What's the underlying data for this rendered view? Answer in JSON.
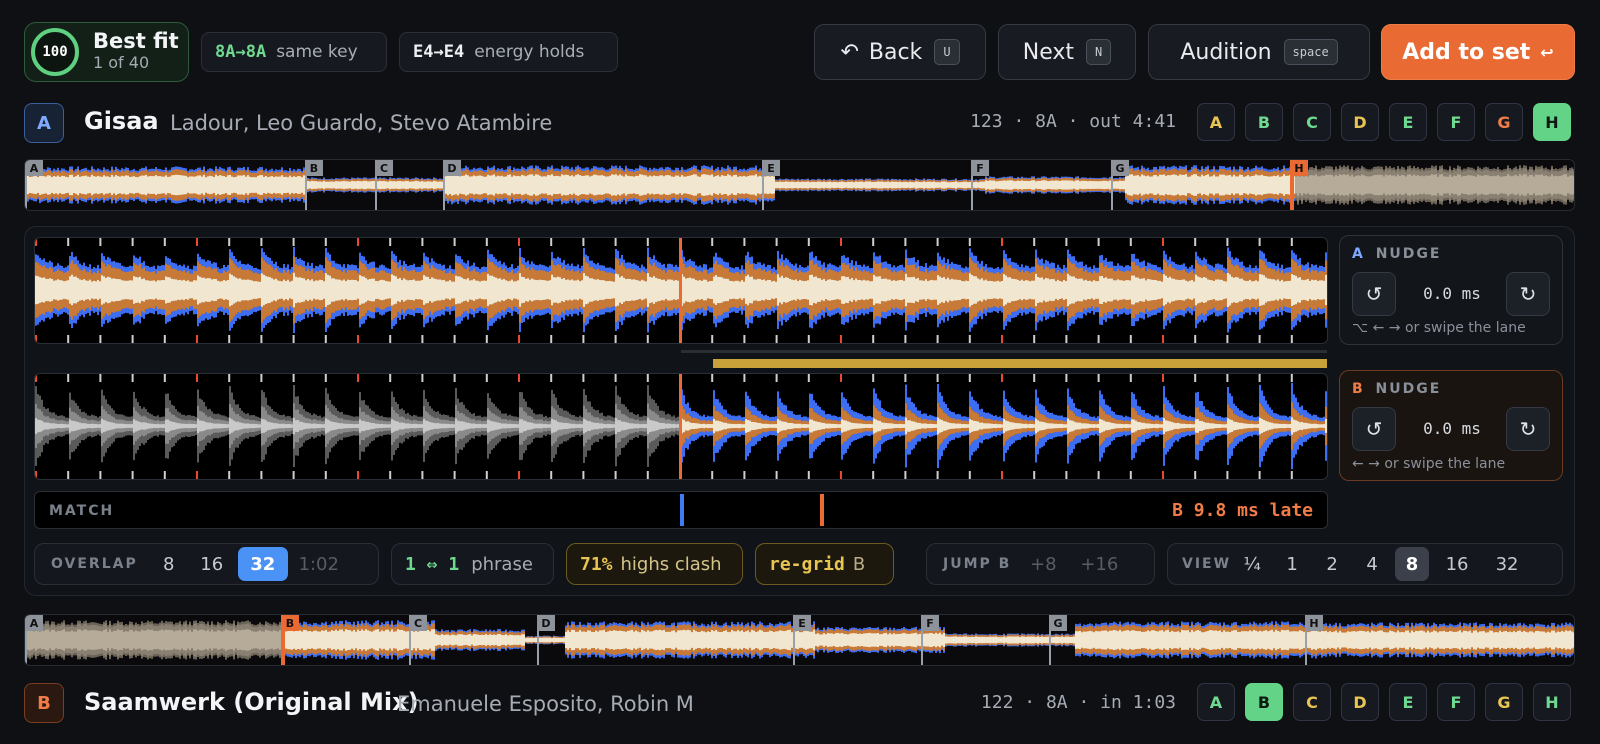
{
  "header": {
    "score": "100",
    "fit_title": "Best fit",
    "fit_sub": "1 of 40",
    "key_change": "8A→8A",
    "key_note": "same key",
    "energy_change": "E4→E4",
    "energy_note": "energy holds"
  },
  "buttons": {
    "back": {
      "label": "Back",
      "key": "U"
    },
    "next": {
      "label": "Next",
      "key": "N"
    },
    "audition": {
      "label": "Audition",
      "key": "space"
    },
    "add": {
      "label": "Add to set",
      "key": "↩"
    }
  },
  "trackA": {
    "deck": "A",
    "title": "Gisaa",
    "artists": "Ladour, Leo Guardo, Stevo Atambire",
    "meta": "123 · 8A · out 4:41",
    "hotcues": [
      "A",
      "B",
      "C",
      "D",
      "E",
      "F",
      "G",
      "H"
    ],
    "active_cue": "H",
    "cue_markers": [
      "A",
      "B",
      "C",
      "D",
      "E",
      "F",
      "G",
      "H"
    ]
  },
  "trackB": {
    "deck": "B",
    "title": "Saamwerk (Original Mix)",
    "artists": "Emanuele Esposito, Robin M",
    "meta": "122 · 8A · in 1:03",
    "hotcues": [
      "A",
      "B",
      "C",
      "D",
      "E",
      "F",
      "G",
      "H"
    ],
    "active_cue": "B",
    "cue_markers": [
      "A",
      "B",
      "C",
      "D",
      "E",
      "F",
      "G",
      "H"
    ]
  },
  "nudgeA": {
    "deck": "A",
    "label": "NUDGE",
    "value": "0.0 ms",
    "hint": "⌥ ← →  or swipe the lane"
  },
  "nudgeB": {
    "deck": "B",
    "label": "NUDGE",
    "value": "0.0 ms",
    "hint": "← →  or swipe the lane"
  },
  "match": {
    "label": "MATCH",
    "status": "B 9.8 ms late"
  },
  "overlap": {
    "label": "OVERLAP",
    "options": [
      "8",
      "16",
      "32",
      "1:02"
    ],
    "selected": "32"
  },
  "phrase": {
    "value": "1 ⇔ 1",
    "note": "phrase"
  },
  "clash": {
    "value": "71%",
    "note": "highs clash"
  },
  "regrid": {
    "label": "re-grid",
    "deck": "B"
  },
  "jump": {
    "label": "JUMP B",
    "options": [
      "+8",
      "+16"
    ]
  },
  "view": {
    "label": "VIEW",
    "options": [
      "¼",
      "1",
      "2",
      "4",
      "8",
      "16",
      "32"
    ],
    "selected": "8"
  },
  "colors": {
    "accent": "#ea6a34",
    "blue": "#3d6df0",
    "orange": "#c77a38",
    "cream": "#f1e6cf",
    "green": "#63d487"
  }
}
